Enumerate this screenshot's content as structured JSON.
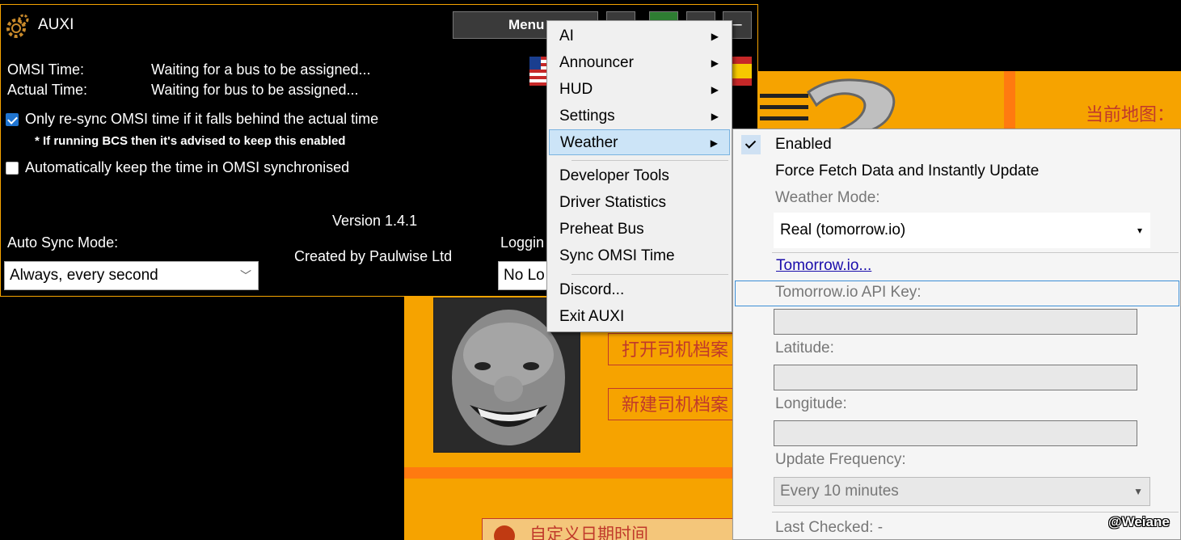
{
  "background_app": {
    "map_label": "当前地图：",
    "open_driver_profile": "打开司机档案",
    "new_driver_profile": "新建司机档案",
    "custom_datetime": "自定义日期时间"
  },
  "auxi": {
    "title": "AUXI",
    "menu_button": "Menu",
    "minimize": "–",
    "omsi_time_label": "OMSI Time:",
    "omsi_time_value": "Waiting for a bus to be assigned...",
    "actual_time_label": "Actual Time:",
    "actual_time_value": "Waiting for bus to be assigned...",
    "resync_option": "Only re-sync OMSI time if it falls behind the actual time",
    "resync_checked": true,
    "bcs_note": "* If running BCS then it's advised to keep this enabled",
    "auto_sync_option": "Automatically keep the time in OMSI synchronised",
    "auto_sync_checked": false,
    "version": "Version 1.4.1",
    "auto_sync_mode_label": "Auto Sync Mode:",
    "auto_sync_mode_value": "Always, every second",
    "created_by": "Created by Paulwise Ltd",
    "logging_label": "Loggin",
    "logging_value": "No Lo"
  },
  "main_menu": {
    "items": [
      {
        "label": "AI",
        "submenu": true
      },
      {
        "label": "Announcer",
        "submenu": true
      },
      {
        "label": "HUD",
        "submenu": true
      },
      {
        "label": "Settings",
        "submenu": true
      },
      {
        "label": "Weather",
        "submenu": true,
        "highlighted": true
      },
      {
        "label": "Developer Tools",
        "submenu": false
      },
      {
        "label": "Driver Statistics",
        "submenu": false
      },
      {
        "label": "Preheat Bus",
        "submenu": false
      },
      {
        "label": "Sync OMSI Time",
        "submenu": false
      },
      {
        "label": "Discord...",
        "submenu": false
      },
      {
        "label": "Exit AUXI",
        "submenu": false
      }
    ]
  },
  "weather_menu": {
    "enabled_label": "Enabled",
    "enabled_checked": true,
    "force_fetch": "Force Fetch Data and Instantly Update",
    "mode_label": "Weather Mode:",
    "mode_value": "Real (tomorrow.io)",
    "link": "Tomorrow.io...",
    "api_key_label": "Tomorrow.io API Key:",
    "api_key_value": "",
    "latitude_label": "Latitude:",
    "latitude_value": "",
    "longitude_label": "Longitude:",
    "longitude_value": "",
    "frequency_label": "Update Frequency:",
    "frequency_value": "Every 10 minutes",
    "last_checked": "Last Checked: -"
  },
  "icons": {
    "submenu_arrow": "▶",
    "dropdown_arrow": "▾",
    "combo_arrow": "▼"
  },
  "watermark": "@Weiane",
  "colors": {
    "accent_orange": "#f6a300",
    "highlight_blue": "#cce4f7",
    "checkbox_blue": "#1f74d0"
  }
}
